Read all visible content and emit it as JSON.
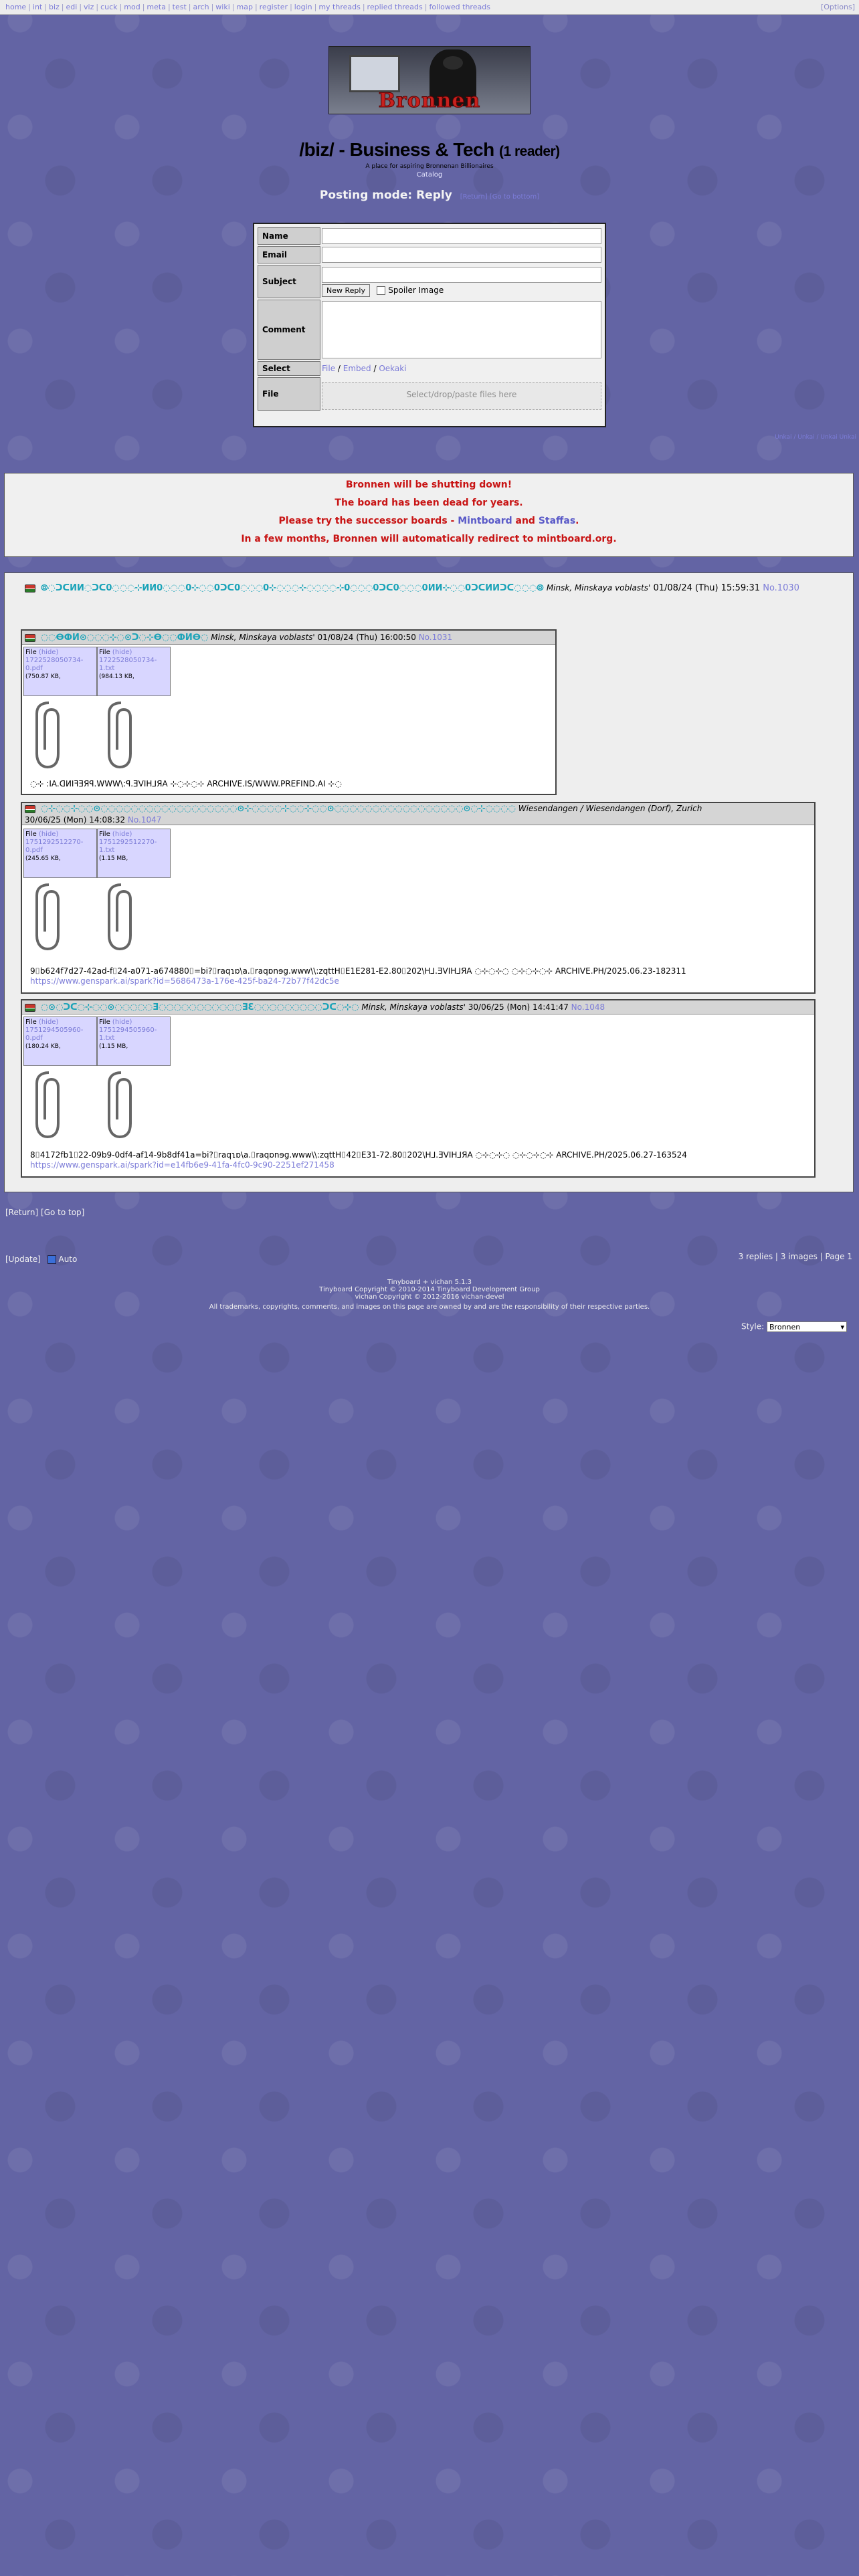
{
  "nav": {
    "items": [
      "home",
      "int",
      "biz",
      "edi",
      "viz",
      "cuck",
      "mod",
      "meta",
      "test",
      "arch",
      "wiki",
      "map",
      "register",
      "login",
      "my threads",
      "replied threads",
      "followed threads"
    ],
    "options": "[Options]"
  },
  "banner": {
    "text": "Bronnen"
  },
  "board": {
    "title": "/biz/ - Business & Tech",
    "readers": "(1 reader)",
    "subtitle": "A place for aspiring Bronnenan Billionaires",
    "catalog": "Catalog",
    "posting_mode": "Posting mode: Reply",
    "return_link": "[Return] [Go to bottom]"
  },
  "form": {
    "labels": {
      "name": "Name",
      "email": "Email",
      "subject": "Subject",
      "comment": "Comment",
      "select": "Select",
      "file": "File"
    },
    "submit": "New Reply",
    "spoiler": "Spoiler Image",
    "select_opts": [
      "File",
      "Embed",
      "Oekaki"
    ],
    "drop_hint": "Select/drop/paste files here"
  },
  "unkai": "Unkai / Unkai / Unkai Unkai",
  "notice": {
    "l1": "Bronnen will be shutting down!",
    "l2": "The board has been dead for years.",
    "l3a": "Please try the successor boards - ",
    "l3b1": "Mintboard",
    "l3c": " and ",
    "l3b2": "Staffas",
    "l3d": ".",
    "l4": "In a few months, Bronnen will automatically redirect to mintboard.org."
  },
  "op": {
    "subject": "⦾◌ᑐᑕИИ◌ᑐᑕ0◌◌◌⊹ИИ0◌◌◌0⊹◌◌0ᑐᑕ0◌◌◌0⊹◌◌◌⊹◌◌◌◌⊹0◌◌◌0ᑐᑕ0◌◌◌0ИИ⊹◌◌0ᑐᑕИИᑐᑕ◌◌◌⦾",
    "author": "Minsk, Minskaya voblasts'",
    "date": "01/08/24 (Thu) 15:59:31",
    "num": "No.1030"
  },
  "replies": [
    {
      "subject": "◌◌ⴱⵀИ⊙◌◌◌⊹◌⊙ᑐ◌⊹ⴱ◌◌ⵀИⴱ◌",
      "author": "Minsk, Minskaya voblasts'",
      "date": "01/08/24 (Thu) 16:00:50",
      "num": "No.1031",
      "files": [
        {
          "label": "File",
          "hide": "(hide)",
          "name": "1722528050734-0.pdf",
          "size": "(750.87 KB,"
        },
        {
          "label": "File",
          "hide": "(hide)",
          "name": "1722528050734-1.txt",
          "size": "(984.13 KB,"
        }
      ],
      "text": "◌⊹ :IA.ᗡИIꟻƎЯꟼ.WWW\\:ꟼ.ƎVIH⅃ЯA ⊹◌⊹◌⊹ ARCHIVE.IS/WWW.PREFIND.AI ⊹◌"
    },
    {
      "subject": "◌⊹◌◌⊹◌◌⊙◌◌◌◌◌◌◌◌◌◌◌◌◌◌◌◌◌◌⊙⊹◌◌◌◌⊹◌◌⊹◌◌⊙◌◌◌◌◌◌◌◌◌◌◌◌◌◌◌◌◌⊙◌⊹◌◌◌◌",
      "author": "Wiesendangen / Wiesendangen (Dorf), Zurich",
      "date": "30/06/25 (Mon) 14:08:32",
      "num": "No.1047",
      "files": [
        {
          "label": "File",
          "hide": "(hide)",
          "name": "1751292512270-0.pdf",
          "size": "(245.65 KB,"
        },
        {
          "label": "File",
          "hide": "(hide)",
          "name": "1751292512270-1.txt",
          "size": "(1.15 MB,"
        }
      ],
      "text": "9⌷b624f7d27-42ad-f⌷24-a071-a674880⌷=bi?⌷raqɿɒ\\a.⌷raqɒnɘg.www\\\\:zqttH⌷E1E281-E2.80⌷202\\H⅃.ƎVIH⅃ЯA  ◌⊹◌⊹◌  ◌⊹◌⊹◌⊹  ARCHIVE.PH/2025.06.23-182311",
      "url": "https://www.genspark.ai/spark?id=5686473a-176e-425f-ba24-72b77f42dc5e"
    },
    {
      "subject": "◌⊙◌ᑐᑕ◌⊹◌◌⊙◌◌◌◌◌Ǝ◌◌◌◌◌◌◌◌◌◌◌ƎƐ◌◌◌◌◌◌◌◌◌ᑐᑕ◌⊹◌",
      "author": "Minsk, Minskaya voblasts'",
      "date": "30/06/25 (Mon) 14:41:47",
      "num": "No.1048",
      "files": [
        {
          "label": "File",
          "hide": "(hide)",
          "name": "1751294505960-0.pdf",
          "size": "(180.24 KB,"
        },
        {
          "label": "File",
          "hide": "(hide)",
          "name": "1751294505960-1.txt",
          "size": "(1.15 MB,"
        }
      ],
      "text": "8⌷4172fb1⌷22-09b9-0df4-af14-9b8df41a=bi?⌷raqɿɒ\\a.⌷raqɒnɘg.www\\\\:zqttH⌷42⌷E31-72.80⌷202\\H⅃.ƎVIH⅃ЯA  ◌⊹◌⊹◌  ◌⊹◌⊹◌⊹  ARCHIVE.PH/2025.06.27-163524",
      "url": "https://www.genspark.ai/spark?id=e14fb6e9-41fa-4fc0-9c90-2251ef271458"
    }
  ],
  "bottom": {
    "return": "[Return]",
    "top": "[Go to top]",
    "update": "[Update]",
    "auto": "Auto",
    "status": "3 replies | 3 images | Page 1"
  },
  "footer": {
    "l1": "Tinyboard + vichan 5.1.3",
    "l2": "Tinyboard Copyright © 2010-2014 Tinyboard Development Group",
    "l3": "vichan Copyright © 2012-2016 vichan-devel",
    "l4": "All trademarks, copyrights, comments, and images on this page are owned by and are the responsibility of their respective parties."
  },
  "style_select": {
    "label": "Style:",
    "value": "Bronnen"
  }
}
